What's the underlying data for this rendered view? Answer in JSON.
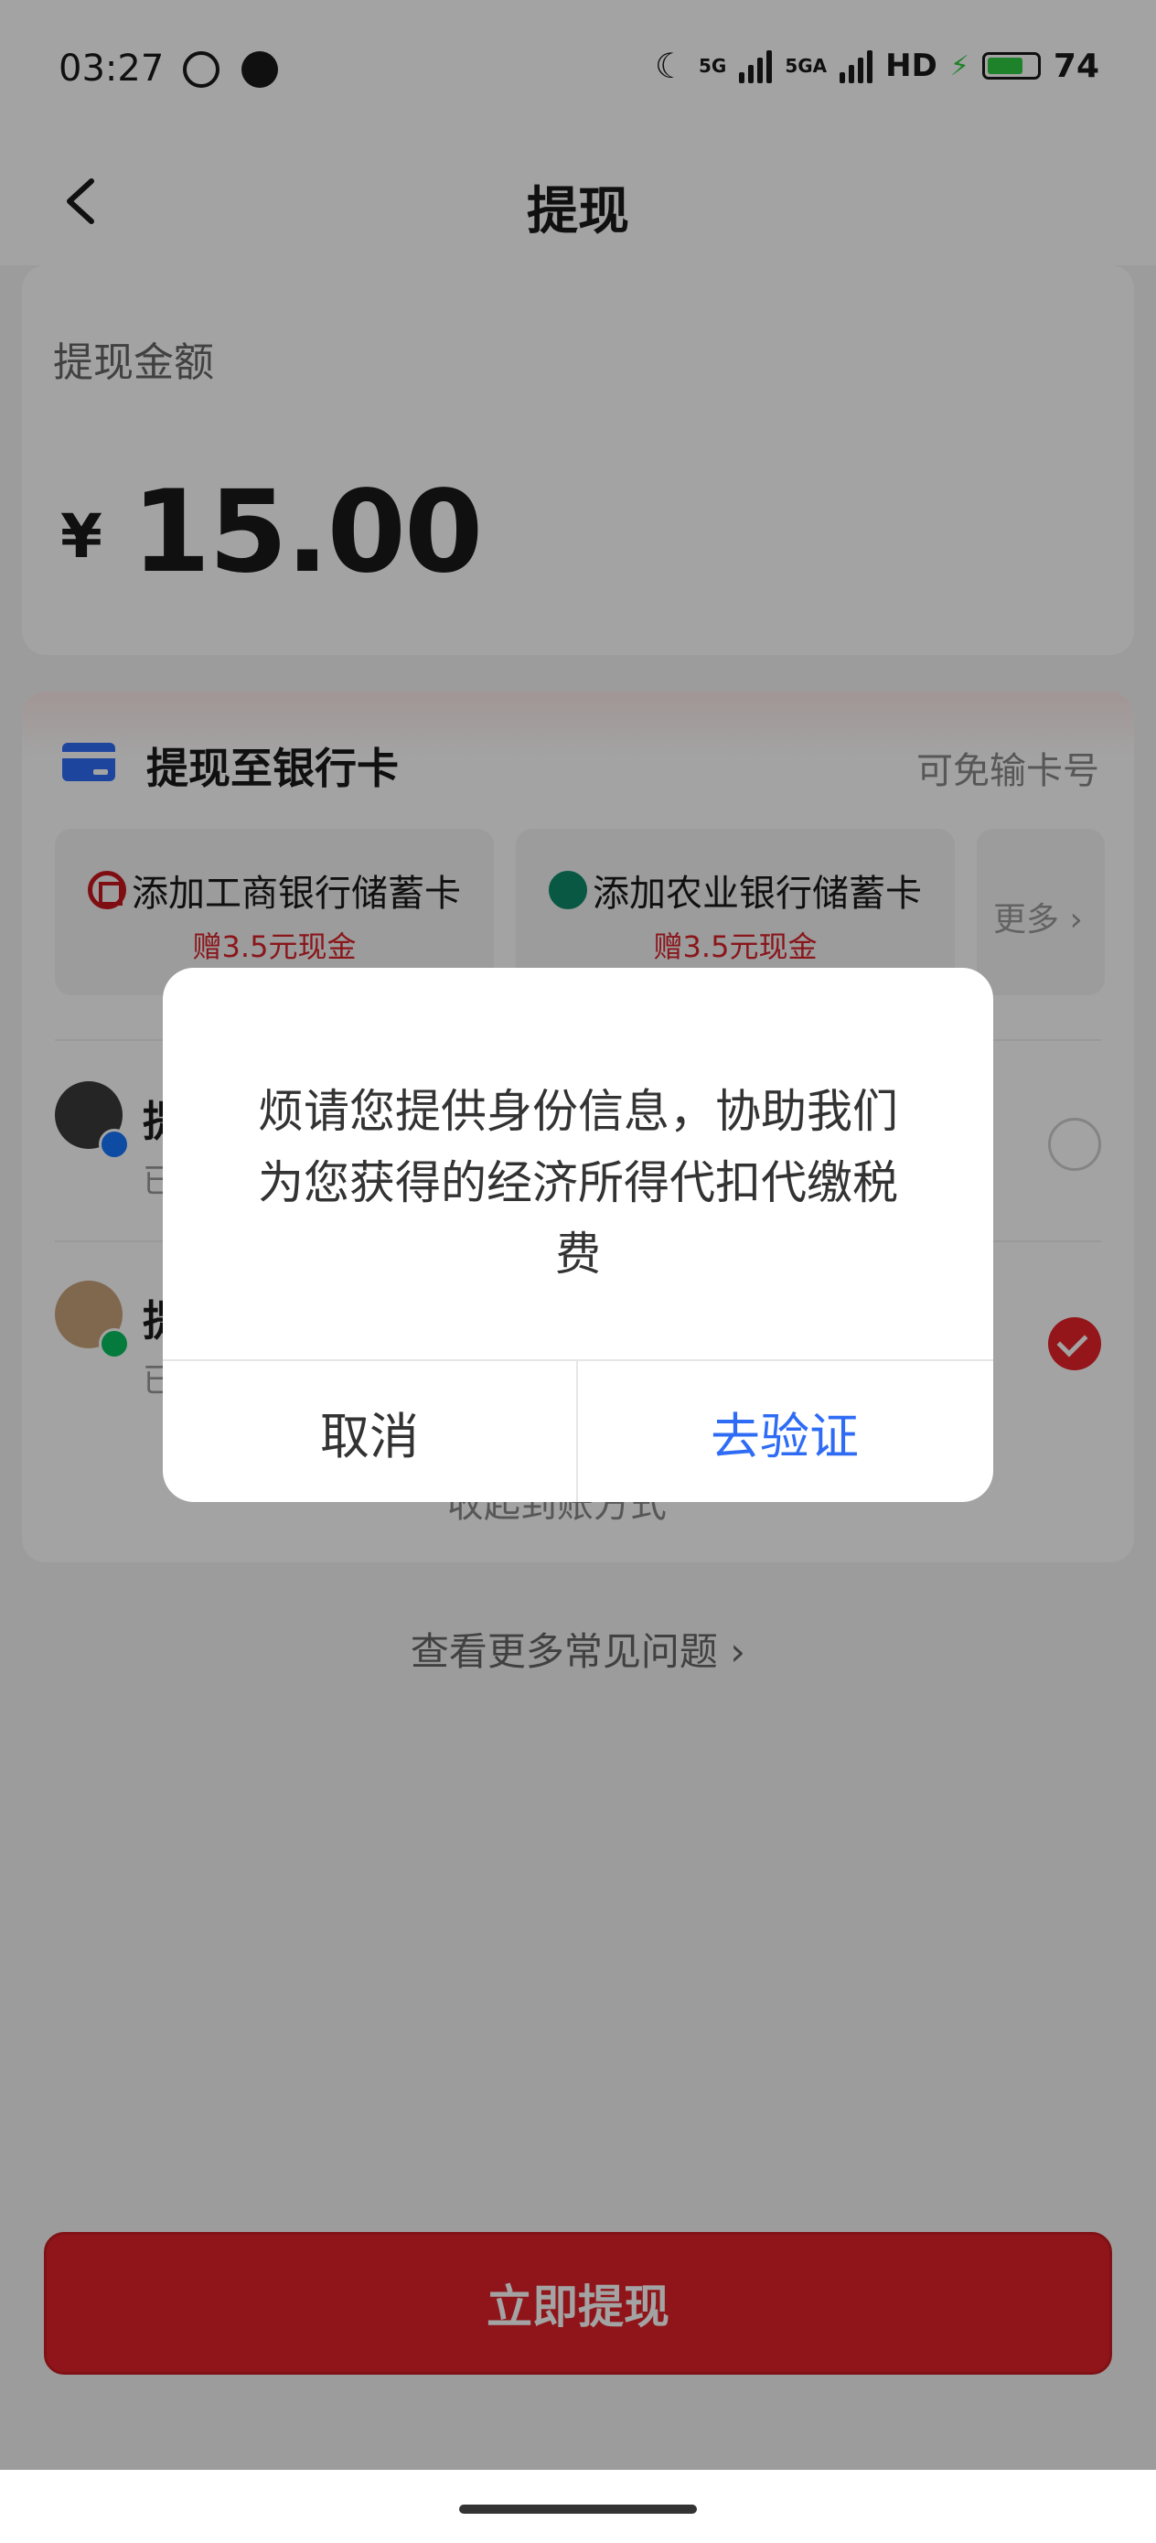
{
  "status_bar": {
    "time": "03:27",
    "network": "5G",
    "network2": "5GA",
    "hd": "HD",
    "battery": "74",
    "battery_level": 0.74
  },
  "header": {
    "title": "提现"
  },
  "amount": {
    "label": "提现金额",
    "currency": "¥",
    "value": "15.00"
  },
  "withdraw": {
    "title": "提现至银行卡",
    "hint": "可免输卡号",
    "bank_options": [
      {
        "label": "添加工商银行储蓄卡",
        "bonus": "赠3.5元现金"
      },
      {
        "label": "添加农业银行储蓄卡",
        "bonus": "赠3.5元现金"
      }
    ],
    "more": "更多 ›",
    "methods": [
      {
        "title": "提",
        "subtitle": "已",
        "selected": false
      },
      {
        "title": "提",
        "subtitle": "已",
        "selected": true
      }
    ],
    "collapse_label": "收起到账方式 ^"
  },
  "faq": {
    "label": "查看更多常见问题 ›"
  },
  "action": {
    "label": "立即提现"
  },
  "dialog": {
    "message": "烦请您提供身份信息，协助我们为您获得的经济所得代扣代缴税费",
    "cancel": "取消",
    "confirm": "去验证"
  },
  "colors": {
    "accent": "#e02229",
    "link": "#2f6cf6"
  }
}
